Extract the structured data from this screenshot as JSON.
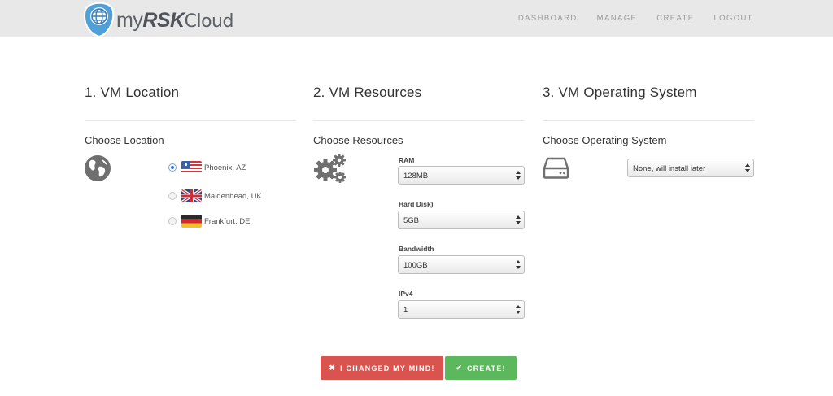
{
  "brand": {
    "prefix": "my",
    "bold": "RSK",
    "suffix": "Cloud"
  },
  "nav": [
    {
      "label": "DASHBOARD"
    },
    {
      "label": "MANAGE"
    },
    {
      "label": "CREATE"
    },
    {
      "label": "LOGOUT"
    }
  ],
  "sections": {
    "location": {
      "title": "1. VM Location",
      "subtitle": "Choose Location",
      "options": [
        {
          "label": "Phoenix, AZ",
          "selected": true
        },
        {
          "label": "Maidenhead, UK",
          "selected": false
        },
        {
          "label": "Frankfurt, DE",
          "selected": false
        }
      ]
    },
    "resources": {
      "title": "2. VM Resources",
      "subtitle": "Choose Resources",
      "fields": [
        {
          "label": "RAM",
          "value": "128MB"
        },
        {
          "label": "Hard Disk)",
          "value": "5GB"
        },
        {
          "label": "Bandwidth",
          "value": "100GB"
        },
        {
          "label": "IPv4",
          "value": "1"
        }
      ]
    },
    "os": {
      "title": "3. VM Operating System",
      "subtitle": "Choose Operating System",
      "value": "None, will install later"
    }
  },
  "actions": {
    "cancel_label": "I CHANGED MY MIND!",
    "create_label": "CREATE!"
  },
  "colors": {
    "cancel": "#d9534f",
    "create": "#5cb85c",
    "topbar": "#e8e8e8"
  }
}
